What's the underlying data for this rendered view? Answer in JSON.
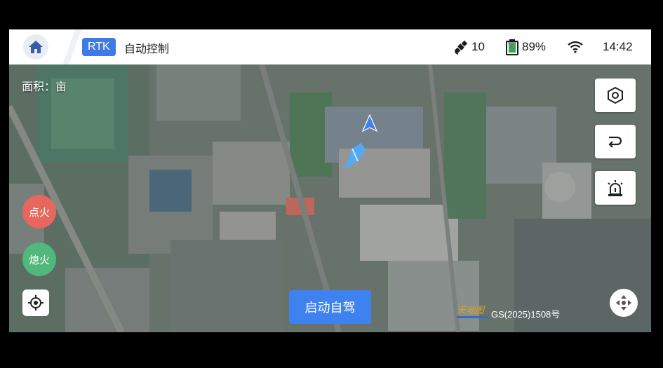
{
  "header": {
    "rtk_label": "RTK",
    "mode_label": "自动控制",
    "satellites": "10",
    "battery": "89%",
    "time": "14:42"
  },
  "map": {
    "area_label": "面积：亩",
    "ignite_label": "点火",
    "extinguish_label": "熄火",
    "start_label": "启动自驾",
    "approval_number": "GS(2025)1508号",
    "logo_text": "天地图"
  },
  "colors": {
    "accent": "#3e7be6",
    "ignite": "#e7675e",
    "extinguish": "#4fb87a",
    "start": "#3e82f0",
    "vehicle": "#56a8f5"
  }
}
